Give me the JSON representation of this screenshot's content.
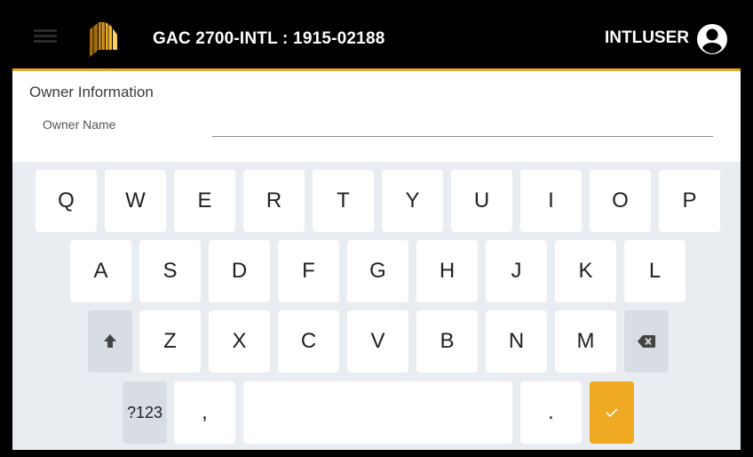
{
  "header": {
    "title": "GAC 2700-INTL : 1915-02188",
    "user": "INTLUSER",
    "menu_icon": "hamburger-menu-icon",
    "logo_icon": "company-logo",
    "avatar_icon": "account-circle-icon"
  },
  "form": {
    "section_title": "Owner Information",
    "owner_name_label": "Owner Name",
    "owner_name_value": ""
  },
  "keyboard": {
    "row1": [
      "Q",
      "W",
      "E",
      "R",
      "T",
      "Y",
      "U",
      "I",
      "O",
      "P"
    ],
    "row2": [
      "A",
      "S",
      "D",
      "F",
      "G",
      "H",
      "J",
      "K",
      "L"
    ],
    "row3": [
      "Z",
      "X",
      "C",
      "V",
      "B",
      "N",
      "M"
    ],
    "shift_icon": "shift-arrow-icon",
    "backspace_icon": "backspace-icon",
    "symbols": "?123",
    "comma": ",",
    "period": ".",
    "enter_icon": "checkmark-icon"
  },
  "colors": {
    "accent": "#e8a923",
    "topbar": "#000000",
    "keyboard_bg": "#e9edf1",
    "fn_key": "#d7dde3",
    "enter_key": "#f0a923"
  }
}
